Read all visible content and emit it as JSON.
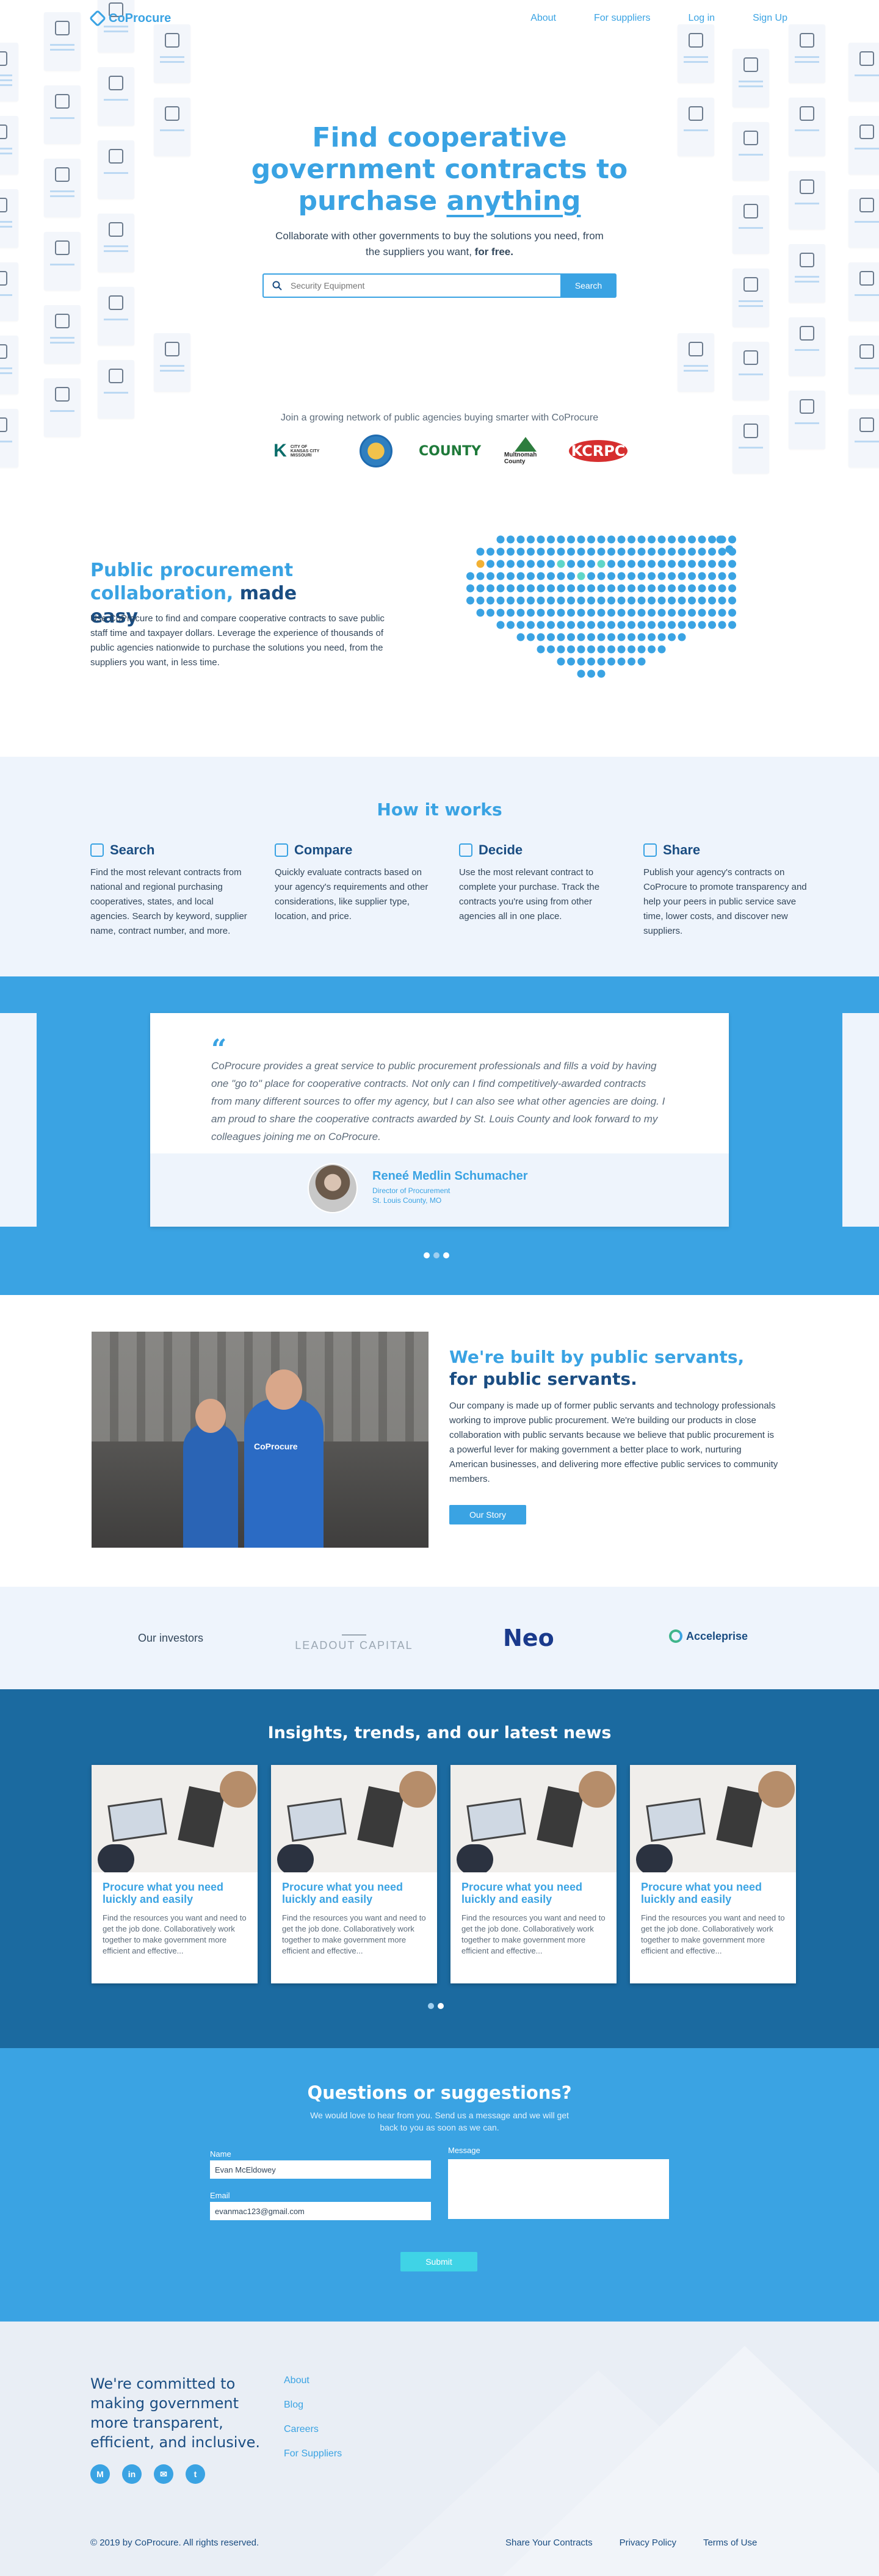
{
  "nav": {
    "brand": "CoProcure",
    "links": [
      "About",
      "For suppliers",
      "Log in",
      "Sign Up"
    ]
  },
  "hero": {
    "title_line1": "Find cooperative",
    "title_line2": "government contracts to",
    "title_line3_prefix": "purchase ",
    "title_emphasis": "anything",
    "subtitle": "Collaborate with other governments to buy the solutions you need, from the suppliers you want, ",
    "subtitle_bold": "for free.",
    "search_placeholder": "Security Equipment",
    "search_button": "Search",
    "network_text": "Join a growing network of public agencies buying smarter with CoProcure",
    "agency_logos": [
      "CITY OF KANSAS CITY MISSOURI",
      "COUNTY",
      "COUNTY",
      "Multnomah County",
      "KCRPC"
    ]
  },
  "collab": {
    "title_blue": "Public procurement collaboration,",
    "title_dark": " made easy",
    "body": "Use CoProcure to find and compare cooperative contracts to save public staff time and taxpayer dollars. Leverage the experience of thousands of public agencies nationwide to purchase the solutions you need, from the suppliers you want, in less time."
  },
  "how": {
    "title": "How it works",
    "steps": [
      {
        "title": "Search",
        "body": "Find the most relevant contracts from national and regional purchasing cooperatives, states, and local agencies. Search by keyword, supplier name, contract number, and more."
      },
      {
        "title": "Compare",
        "body": "Quickly evaluate contracts based on your agency's requirements and other considerations, like supplier type, location, and price."
      },
      {
        "title": "Decide",
        "body": "Use the most relevant contract to complete your purchase. Track the contracts you're using from other agencies all in one place."
      },
      {
        "title": "Share",
        "body": "Publish your agency's contracts on CoProcure to promote transparency and help your peers in public service save time, lower costs, and discover new suppliers."
      }
    ]
  },
  "testimonial": {
    "quote": "CoProcure provides a great service to public procurement professionals and fills a void by having one \"go to\" place for cooperative contracts. Not only can I find competitively-awarded contracts from many different sources to offer my agency, but I can also see what other agencies are doing. I am proud to share the cooperative contracts awarded by St. Louis County and look forward to my colleagues joining me on CoProcure.",
    "name": "Reneé Medlin Schumacher",
    "role": "Director of Procurement",
    "location": "St. Louis County, MO"
  },
  "servants": {
    "title_blue": "We're built by public servants,",
    "title_dark": "for public servants.",
    "body": "Our company is made up of former public servants and technology professionals working to improve public procurement. We're building our products in close collaboration with public servants because we believe that public procurement is a powerful lever for making government a better place to work, nurturing American businesses, and delivering more effective public services to community members.",
    "button": "Our Story",
    "shirt_text": "CoProcure"
  },
  "investors": {
    "label": "Our investors",
    "names": [
      "LEADOUT CAPITAL",
      "Neo",
      "Acceleprise"
    ]
  },
  "news": {
    "title": "Insights, trends, and our latest news",
    "cards": [
      {
        "title": "Procure what you need luickly and easily",
        "body": "Find the resources you want and need to get the job done. Collaboratively work together to make government more efficient and effective..."
      },
      {
        "title": "Procure what you need luickly and easily",
        "body": "Find the resources you want and need to get the job done. Collaboratively work together to make government more efficient and effective..."
      },
      {
        "title": "Procure what you need luickly and easily",
        "body": "Find the resources you want and need to get the job done. Collaboratively work together to make government more efficient and effective..."
      },
      {
        "title": "Procure what you need luickly and easily",
        "body": "Find the resources you want and need to get the job done. Collaboratively work together to make government more efficient and effective..."
      }
    ]
  },
  "contact": {
    "title": "Questions or suggestions?",
    "lead": "We would love to hear from you. Send us a message and we will get back to you as soon as we can.",
    "name_label": "Name",
    "name_value": "Evan McEldowey",
    "email_label": "Email",
    "email_value": "evanmac123@gmail.com",
    "message_label": "Message",
    "submit": "Submit"
  },
  "footer": {
    "tagline": "We're committed to making government more transparent, efficient, and inclusive.",
    "links": [
      "About",
      "Blog",
      "Careers",
      "For Suppliers"
    ],
    "social": [
      "medium-icon",
      "linkedin-icon",
      "mail-icon",
      "twitter-icon"
    ],
    "copyright": "© 2019 by CoProcure. All rights reserved.",
    "legal": [
      "Share Your Contracts",
      "Privacy Policy",
      "Terms of Use"
    ]
  },
  "colors": {
    "accent": "#3aa3e3",
    "navy": "#1a4d82",
    "news_bg": "#1b6aa0",
    "light_bg": "#eef4fc"
  }
}
